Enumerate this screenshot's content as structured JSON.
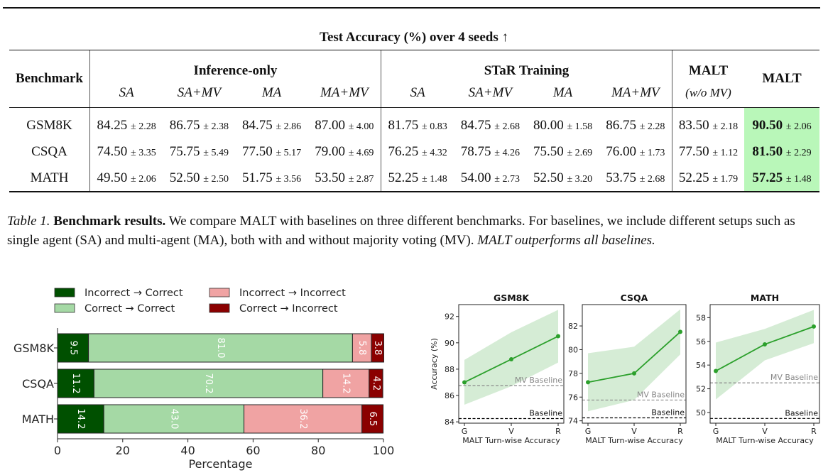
{
  "table": {
    "caption_title": "Test Accuracy (%) over 4 seeds ↑",
    "header": {
      "benchmark": "Benchmark",
      "groups": [
        "Inference-only",
        "STaR Training",
        "MALT",
        "MALT"
      ],
      "malt_wo_mv_sub": "(w/o MV)",
      "sub": [
        "SA",
        "SA+MV",
        "MA",
        "MA+MV",
        "SA",
        "SA+MV",
        "MA",
        "MA+MV"
      ]
    },
    "rows": [
      {
        "benchmark": "GSM8K",
        "cells": [
          {
            "mean": "84.25",
            "sd": "± 2.28"
          },
          {
            "mean": "86.75",
            "sd": "± 2.38"
          },
          {
            "mean": "84.75",
            "sd": "± 2.86"
          },
          {
            "mean": "87.00",
            "sd": "± 4.00"
          },
          {
            "mean": "81.75",
            "sd": "± 0.83"
          },
          {
            "mean": "84.75",
            "sd": "± 2.68"
          },
          {
            "mean": "80.00",
            "sd": "± 1.58"
          },
          {
            "mean": "86.75",
            "sd": "± 2.28"
          },
          {
            "mean": "83.50",
            "sd": "± 2.18"
          },
          {
            "mean": "90.50",
            "sd": "± 2.06"
          }
        ]
      },
      {
        "benchmark": "CSQA",
        "cells": [
          {
            "mean": "74.50",
            "sd": "± 3.35"
          },
          {
            "mean": "75.75",
            "sd": "± 5.49"
          },
          {
            "mean": "77.50",
            "sd": "± 5.17"
          },
          {
            "mean": "79.00",
            "sd": "± 4.69"
          },
          {
            "mean": "76.25",
            "sd": "± 4.32"
          },
          {
            "mean": "78.75",
            "sd": "± 4.26"
          },
          {
            "mean": "75.50",
            "sd": "± 2.69"
          },
          {
            "mean": "76.00",
            "sd": "± 1.73"
          },
          {
            "mean": "77.50",
            "sd": "± 1.12"
          },
          {
            "mean": "81.50",
            "sd": "± 2.29"
          }
        ]
      },
      {
        "benchmark": "MATH",
        "cells": [
          {
            "mean": "49.50",
            "sd": "± 2.06"
          },
          {
            "mean": "52.50",
            "sd": "± 2.50"
          },
          {
            "mean": "51.75",
            "sd": "± 3.56"
          },
          {
            "mean": "53.50",
            "sd": "± 2.87"
          },
          {
            "mean": "52.25",
            "sd": "± 1.48"
          },
          {
            "mean": "54.00",
            "sd": "± 2.73"
          },
          {
            "mean": "52.50",
            "sd": "± 3.20"
          },
          {
            "mean": "53.75",
            "sd": "± 2.68"
          },
          {
            "mean": "52.25",
            "sd": "± 1.79"
          },
          {
            "mean": "57.25",
            "sd": "± 1.48"
          }
        ]
      }
    ],
    "highlight_color": "#b9f7b9"
  },
  "caption": {
    "label": "Table 1.",
    "title": "Benchmark results.",
    "text": " We compare MALT with baselines on three different benchmarks. For baselines, we include different setups such as single agent (SA) and multi-agent (MA), both with and without majority voting (MV). ",
    "emphasis": "MALT outperforms all baselines."
  },
  "chart_data": [
    {
      "type": "bar",
      "orientation": "horizontal-stacked",
      "categories": [
        "GSM8K",
        "CSQA",
        "MATH"
      ],
      "series": [
        {
          "name": "Incorrect → Correct",
          "color": "#005000",
          "values": [
            9.5,
            11.2,
            14.2
          ]
        },
        {
          "name": "Correct → Correct",
          "color": "#a5d9a5",
          "values": [
            81.0,
            70.2,
            43.0
          ]
        },
        {
          "name": "Incorrect → Incorrect",
          "color": "#f0a3a3",
          "values": [
            5.8,
            14.2,
            36.2
          ]
        },
        {
          "name": "Correct → Incorrect",
          "color": "#8b0000",
          "values": [
            3.8,
            4.2,
            6.5
          ]
        }
      ],
      "xlabel": "Percentage",
      "xlim": [
        0,
        100
      ],
      "xticks": [
        "0",
        "20",
        "40",
        "60",
        "80",
        "100"
      ],
      "legend": "top",
      "data_labels": true
    },
    {
      "type": "line",
      "title": "GSM8K",
      "x": [
        "G",
        "V",
        "R"
      ],
      "values": [
        87.0,
        88.75,
        90.5
      ],
      "band_low": [
        85.3,
        86.7,
        88.5
      ],
      "band_high": [
        88.7,
        90.8,
        92.5
      ],
      "baselines": [
        {
          "label": "MV Baseline",
          "value": 86.75,
          "color": "#888888"
        },
        {
          "label": "Baseline",
          "value": 84.25,
          "color": "#000000"
        }
      ],
      "ylim": [
        83.9,
        92.9
      ],
      "yticks": [
        84,
        86,
        88,
        90,
        92
      ],
      "ylabel": "Accuracy (%)",
      "xlabel": "MALT Turn-wise Accuracy"
    },
    {
      "type": "line",
      "title": "CSQA",
      "x": [
        "G",
        "V",
        "R"
      ],
      "values": [
        77.25,
        78.0,
        81.5
      ],
      "band_low": [
        74.8,
        75.75,
        79.6
      ],
      "band_high": [
        79.7,
        80.25,
        83.4
      ],
      "baselines": [
        {
          "label": "MV Baseline",
          "value": 75.75,
          "color": "#888888"
        },
        {
          "label": "Baseline",
          "value": 74.25,
          "color": "#000000"
        }
      ],
      "ylim": [
        73.8,
        83.8
      ],
      "yticks": [
        74,
        76,
        78,
        80,
        82
      ],
      "ylabel": "",
      "xlabel": "MALT Turn-wise Accuracy"
    },
    {
      "type": "line",
      "title": "MATH",
      "x": [
        "G",
        "V",
        "R"
      ],
      "values": [
        53.5,
        55.75,
        57.25
      ],
      "band_low": [
        51.1,
        54.4,
        55.85
      ],
      "band_high": [
        55.9,
        57.05,
        58.65
      ],
      "baselines": [
        {
          "label": "MV Baseline",
          "value": 52.5,
          "color": "#888888"
        },
        {
          "label": "Baseline",
          "value": 49.5,
          "color": "#000000"
        }
      ],
      "ylim": [
        49.1,
        59.1
      ],
      "yticks": [
        50,
        52,
        54,
        56,
        58
      ],
      "ylabel": "",
      "xlabel": "MALT Turn-wise Accuracy"
    }
  ]
}
